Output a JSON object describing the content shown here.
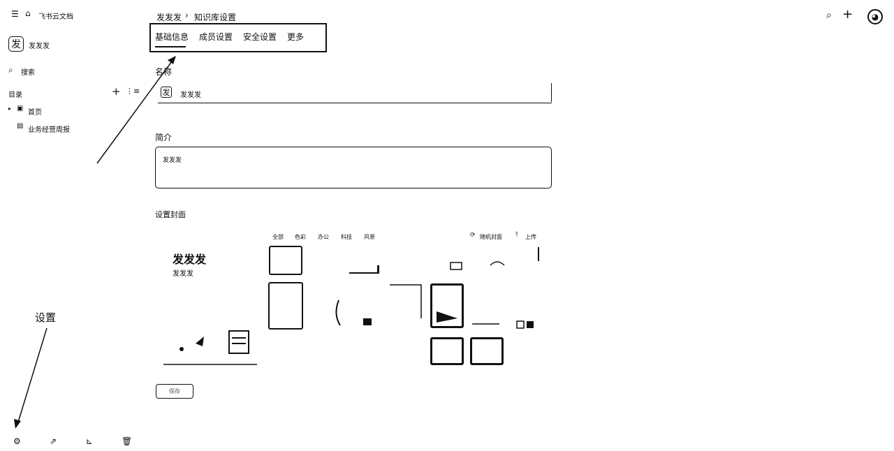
{
  "sidebar": {
    "app_title": "飞书云文档",
    "space_avatar_char": "发",
    "space_name": "发发发",
    "search_label": "搜索",
    "catalog_label": "目录",
    "tree": [
      {
        "label": "首页"
      },
      {
        "label": "业务经营周报"
      }
    ],
    "icons": {
      "collapse": "sidebar-toggle-icon",
      "home": "home-icon",
      "search": "search-icon",
      "add": "plus-icon",
      "tree_view": "list-icon",
      "settings": "gear-icon",
      "share": "share-icon",
      "template": "template-icon",
      "trash": "trash-icon"
    }
  },
  "breadcrumb": {
    "space": "发发发",
    "separator": "›",
    "current": "知识库设置"
  },
  "tabs": [
    {
      "label": "基础信息",
      "active": true
    },
    {
      "label": "成员设置",
      "active": false
    },
    {
      "label": "安全设置",
      "active": false
    },
    {
      "label": "更多",
      "active": false
    }
  ],
  "form": {
    "name_label": "名称",
    "name_avatar_char": "发",
    "name_value": "发发发",
    "intro_label": "简介",
    "intro_value": "发发发",
    "cover_label": "设置封面",
    "confirm_button": "保存"
  },
  "cover": {
    "preview_title": "发发发",
    "preview_subtitle": "发发发",
    "categories": [
      "全部",
      "色彩",
      "办公",
      "科技",
      "风景"
    ],
    "random_label": "随机封面",
    "upload_label": "上传"
  },
  "annotation": {
    "settings_note": "设置"
  },
  "colors": {
    "background": "#ffffff",
    "foreground": "#111111"
  }
}
